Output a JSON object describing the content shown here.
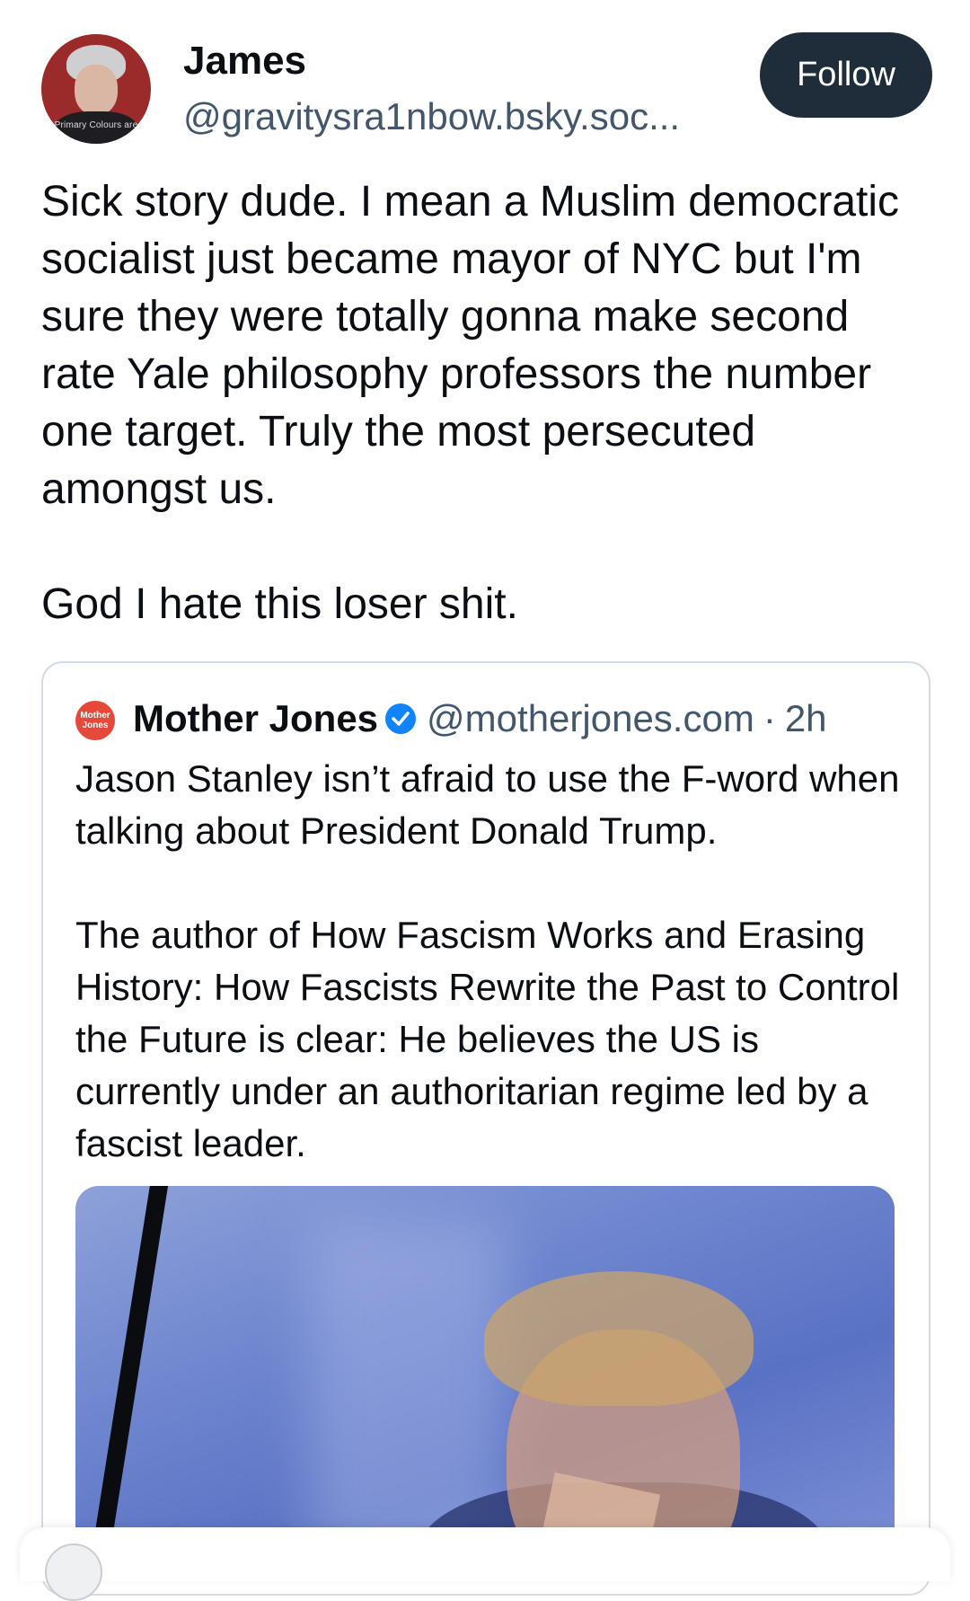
{
  "post": {
    "author": {
      "name": "James",
      "handle": "@gravitysra1nbow.bsky.soc...",
      "avatar_caption": "Primary Colours are"
    },
    "follow_label": "Follow",
    "text_paragraphs": [
      "Sick story dude. I mean a Muslim democratic socialist just became mayor of NYC but I'm sure they were totally gonna make second rate Yale philosophy professors the number one target. Truly the most persecuted amongst us.",
      "God I hate this loser shit."
    ]
  },
  "quote": {
    "logo_text_line1": "Mother",
    "logo_text_line2": "Jones",
    "name": "Mother Jones",
    "verified_icon": "verified-badge",
    "handle": "@motherjones.com",
    "separator": "·",
    "time": "2h",
    "text_paragraphs": [
      "Jason Stanley isn’t afraid to use the F-word when talking about President Donald Trump.",
      "The author of How Fascism Works and Erasing History: How Fascists Rewrite the Past to Control the Future is clear: He believes the US is currently under an authoritarian regime led by a fascist leader."
    ]
  },
  "colors": {
    "follow_button": "#1f2d3a",
    "handle_text": "#42576c",
    "verified": "#1083fe",
    "card_border": "#d4dbe2"
  }
}
